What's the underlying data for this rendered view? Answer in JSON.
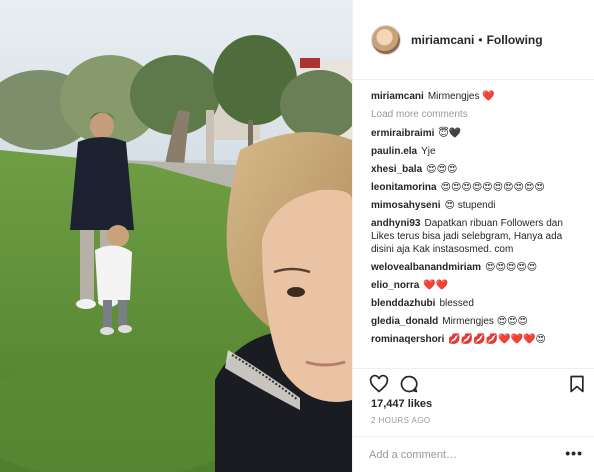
{
  "post": {
    "photo_alt": "",
    "header": {
      "username": "miriamcani",
      "separator": "•",
      "follow_status": "Following"
    },
    "load_more": "Load more comments",
    "comments": [
      {
        "user": "miriamcani",
        "text": "Mirmengjes ❤️"
      },
      {
        "user": "ermiraibraimi",
        "text": "😇🖤"
      },
      {
        "user": "paulin.ela",
        "text": "Yje"
      },
      {
        "user": "xhesi_bala",
        "text": "😍😍😍"
      },
      {
        "user": "leonitamorina",
        "text": "😍😍😍😍😍😍😍😍😍😍"
      },
      {
        "user": "mimosahyseni",
        "text": "😍 stupendi"
      },
      {
        "user": "andhyni93",
        "text": "Dapatkan ribuan Followers dan Likes terus bisa jadi selebgram, Hanya ada disini aja Kak instasosmed. com"
      },
      {
        "user": "welovealbanandmiriam",
        "text": "😍😍😍😍😍"
      },
      {
        "user": "elio_norra",
        "text": "❤️❤️"
      },
      {
        "user": "blenddazhubi",
        "text": "blessed"
      },
      {
        "user": "gledia_donald",
        "text": "Mirmengjes 😍😍😍"
      },
      {
        "user": "rominaqershori",
        "text": "💋💋💋💋❤️❤️❤️😍"
      }
    ],
    "actions": {
      "like_icon": "heart-icon",
      "comment_icon": "comment-bubble-icon",
      "save_icon": "bookmark-icon"
    },
    "likes": "17,447 likes",
    "timestamp": "2 HOURS AGO",
    "add_comment_placeholder": "Add a comment…",
    "more_options": "•••",
    "colors": {
      "text": "#262626",
      "muted": "#999999",
      "border": "#efefef",
      "heart": "#ed4956"
    }
  }
}
